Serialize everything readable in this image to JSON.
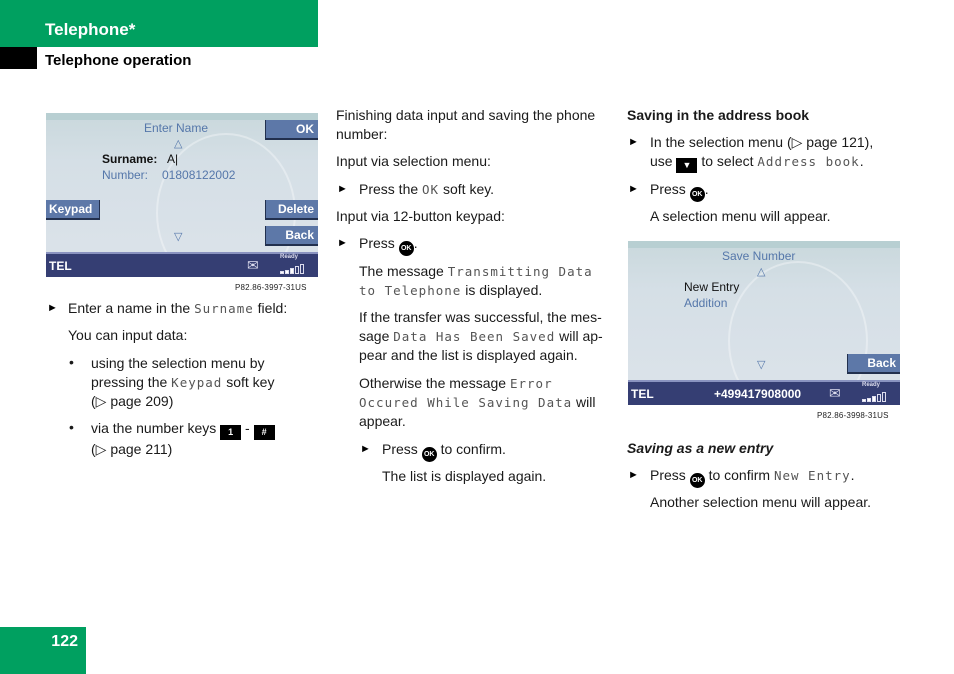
{
  "header": {
    "section": "Telephone*",
    "subsection": "Telephone operation"
  },
  "page_number": "122",
  "screen1": {
    "title": "Enter Name",
    "up_arrow": "△",
    "down_arrow": "▽",
    "surname_label": "Surname:",
    "surname_value": "A|",
    "number_label": "Number:",
    "number_value": "01808122002",
    "softkeys": {
      "ok": "OK",
      "keypad": "Keypad",
      "delete": "Delete",
      "back": "Back"
    },
    "status": {
      "tel": "TEL",
      "mail_icon": "✉",
      "ready": "Ready"
    },
    "caption": "P82.86-3997-31US"
  },
  "screen2": {
    "title": "Save Number",
    "up_arrow": "△",
    "down_arrow": "▽",
    "items": [
      "New Entry",
      "Addition"
    ],
    "softkeys": {
      "back": "Back"
    },
    "status": {
      "tel": "TEL",
      "number": "+499417908000",
      "mail_icon": "✉",
      "ready": "Ready"
    },
    "caption": "P82.86-3998-31US"
  },
  "col1": {
    "step1_a": "Enter a name in the ",
    "step1_mono": "Surname",
    "step1_b": " field:",
    "input_intro": "You can input data:",
    "b1_line1": "using the selection menu by",
    "b1_line2a": "pressing the ",
    "b1_mono": "Keypad",
    "b1_line2b": " soft key",
    "b1_line3": "(▷ page 209)",
    "b2_line1": "via the number keys ",
    "key_1": "1",
    "key_dash": " - ",
    "key_hash": "#",
    "b2_line2": "(▷ page 211)"
  },
  "col2": {
    "p1_line1": "Finishing data input and saving the phone",
    "p1_line2": "number:",
    "p2": "Input via selection menu:",
    "s1_a": "Press the ",
    "s1_mono": "OK",
    "s1_b": " soft key.",
    "p3": "Input via 12-button keypad:",
    "s2_a": "Press ",
    "ok": "OK",
    "s2_b": ".",
    "m1_a": "The message ",
    "m1_mono1": "Transmitting Data",
    "m1_mono2": "to Telephone",
    "m1_b": " is displayed.",
    "m2_line1": "If the transfer was successful, the mes-",
    "m2_a": "sage ",
    "m2_mono": "Data Has Been Saved",
    "m2_b": " will ap-",
    "m2_line3": "pear and the list is displayed again.",
    "m3_a": "Otherwise the message ",
    "m3_mono1": "Error",
    "m3_mono2": "Occured While Saving Data",
    "m3_b": " will",
    "m3_line3": "appear.",
    "s3_a": "Press ",
    "s3_b": " to confirm.",
    "s3_result": "The list is displayed again."
  },
  "col3": {
    "heading": "Saving in the address book",
    "s1_line1": "In the selection menu (▷ page 121),",
    "s1_a": "use ",
    "down_key": "▼",
    "s1_b": " to select ",
    "s1_mono": "Address book",
    "s1_c": ".",
    "s2_a": "Press ",
    "s2_b": ".",
    "s2_result": "A selection menu will appear.",
    "heading2": "Saving as a new entry",
    "s3_a": "Press ",
    "s3_b": " to confirm ",
    "s3_mono": "New Entry",
    "s3_c": ".",
    "s3_result": "Another selection menu will appear."
  },
  "bullet_glyph": "►",
  "dot_glyph": "•"
}
